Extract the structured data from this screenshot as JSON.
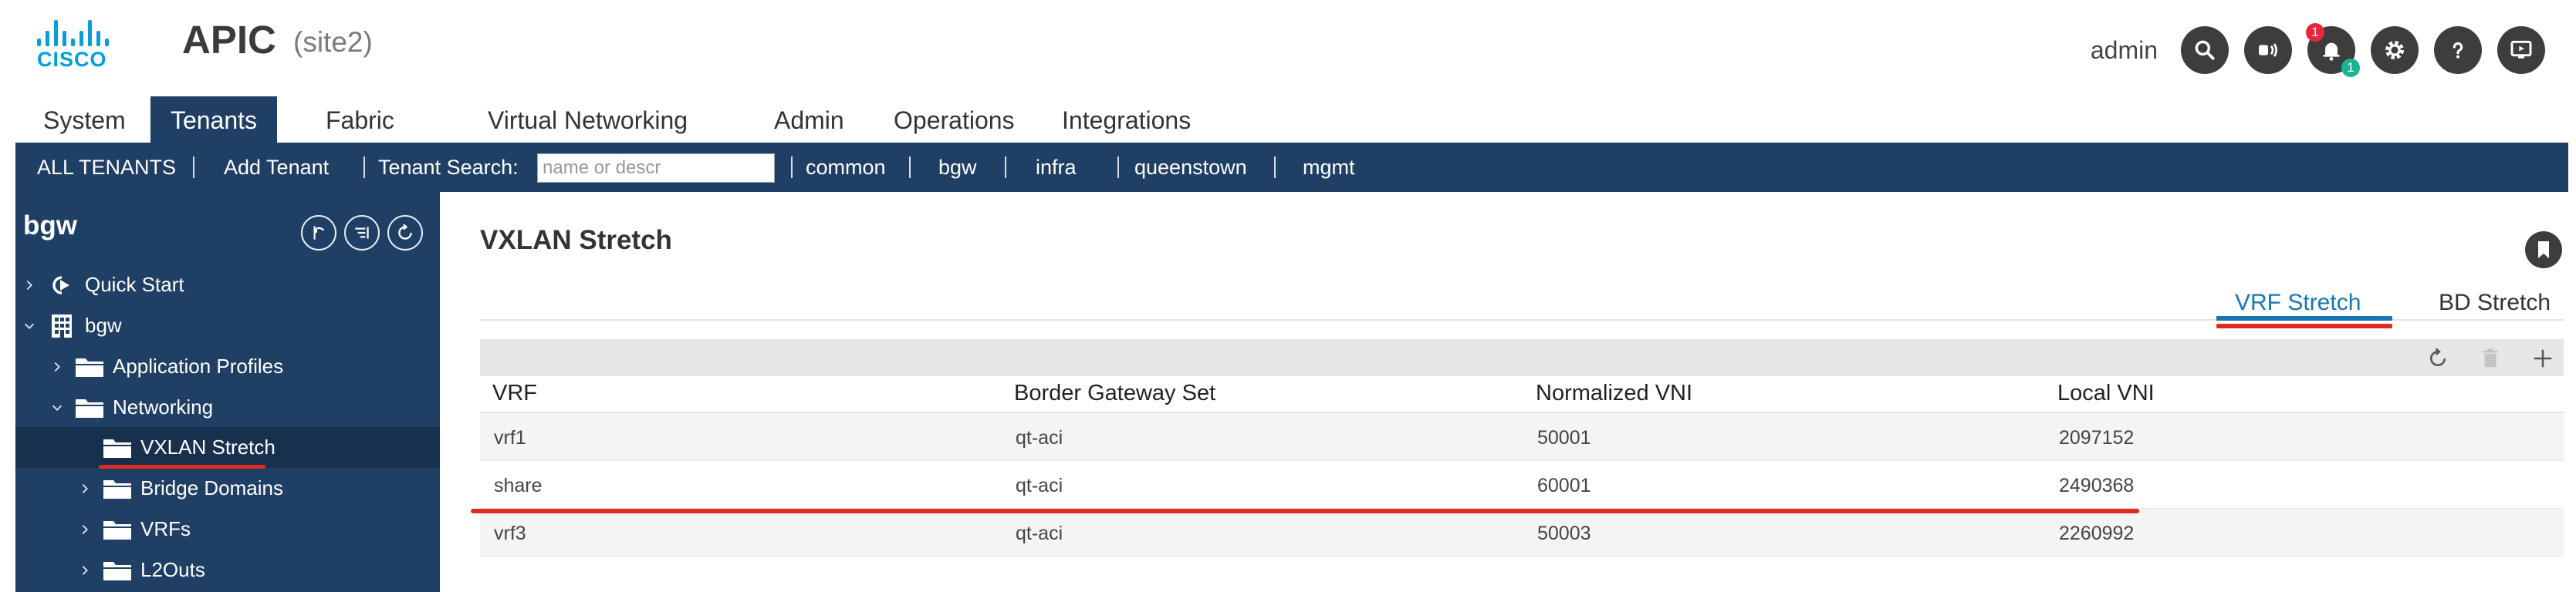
{
  "header": {
    "logo_text": "CISCO",
    "app_title": "APIC",
    "site": "(site2)",
    "username": "admin",
    "icons": [
      "search-icon",
      "broadcast-icon",
      "bell-icon",
      "gear-icon",
      "help-icon",
      "screen-icon"
    ],
    "bell_badge_red": "1",
    "bell_badge_teal": "1",
    "badge_colors": {
      "red": "#e8253b",
      "teal": "#1ab394"
    }
  },
  "nav": {
    "tabs": [
      "System",
      "Tenants",
      "Fabric",
      "Virtual Networking",
      "Admin",
      "Operations",
      "Integrations"
    ],
    "active": "Tenants"
  },
  "tenant_bar": {
    "all_tenants": "ALL TENANTS",
    "add_tenant": "Add Tenant",
    "search_label": "Tenant Search:",
    "search_placeholder": "name or descr",
    "tenants": [
      "common",
      "bgw",
      "infra",
      "queenstown",
      "mgmt"
    ]
  },
  "sidebar": {
    "title": "bgw",
    "tools": [
      "pin-icon",
      "list-icon",
      "refresh-icon"
    ],
    "tree": [
      {
        "label": "Quick Start",
        "icon": "quickstart-icon",
        "expanded": false
      },
      {
        "label": "bgw",
        "icon": "building-icon",
        "expanded": true
      },
      {
        "label": "Application Profiles",
        "icon": "folder-icon",
        "expanded": false
      },
      {
        "label": "Networking",
        "icon": "folder-icon",
        "expanded": true
      },
      {
        "label": "VXLAN Stretch",
        "icon": "folder-icon",
        "selected": true
      },
      {
        "label": "Bridge Domains",
        "icon": "folder-icon",
        "expanded": false
      },
      {
        "label": "VRFs",
        "icon": "folder-icon",
        "expanded": false
      },
      {
        "label": "L2Outs",
        "icon": "folder-icon",
        "expanded": false
      }
    ]
  },
  "main": {
    "title": "VXLAN Stretch",
    "subtabs": [
      "VRF Stretch",
      "BD Stretch"
    ],
    "active_subtab": "VRF Stretch",
    "toolbar_icons": [
      "refresh-icon",
      "trash-icon",
      "plus-icon"
    ],
    "table": {
      "columns": [
        "VRF",
        "Border Gateway Set",
        "Normalized VNI",
        "Local VNI"
      ],
      "rows": [
        [
          "vrf1",
          "qt-aci",
          "50001",
          "2097152"
        ],
        [
          "share",
          "qt-aci",
          "60001",
          "2490368"
        ],
        [
          "vrf3",
          "qt-aci",
          "50003",
          "2260992"
        ]
      ]
    }
  },
  "colors": {
    "brand_blue": "#049fd9",
    "nav_dark": "#1f3f64",
    "accent_blue": "#1677b2",
    "highlight_red": "#e02b20"
  }
}
